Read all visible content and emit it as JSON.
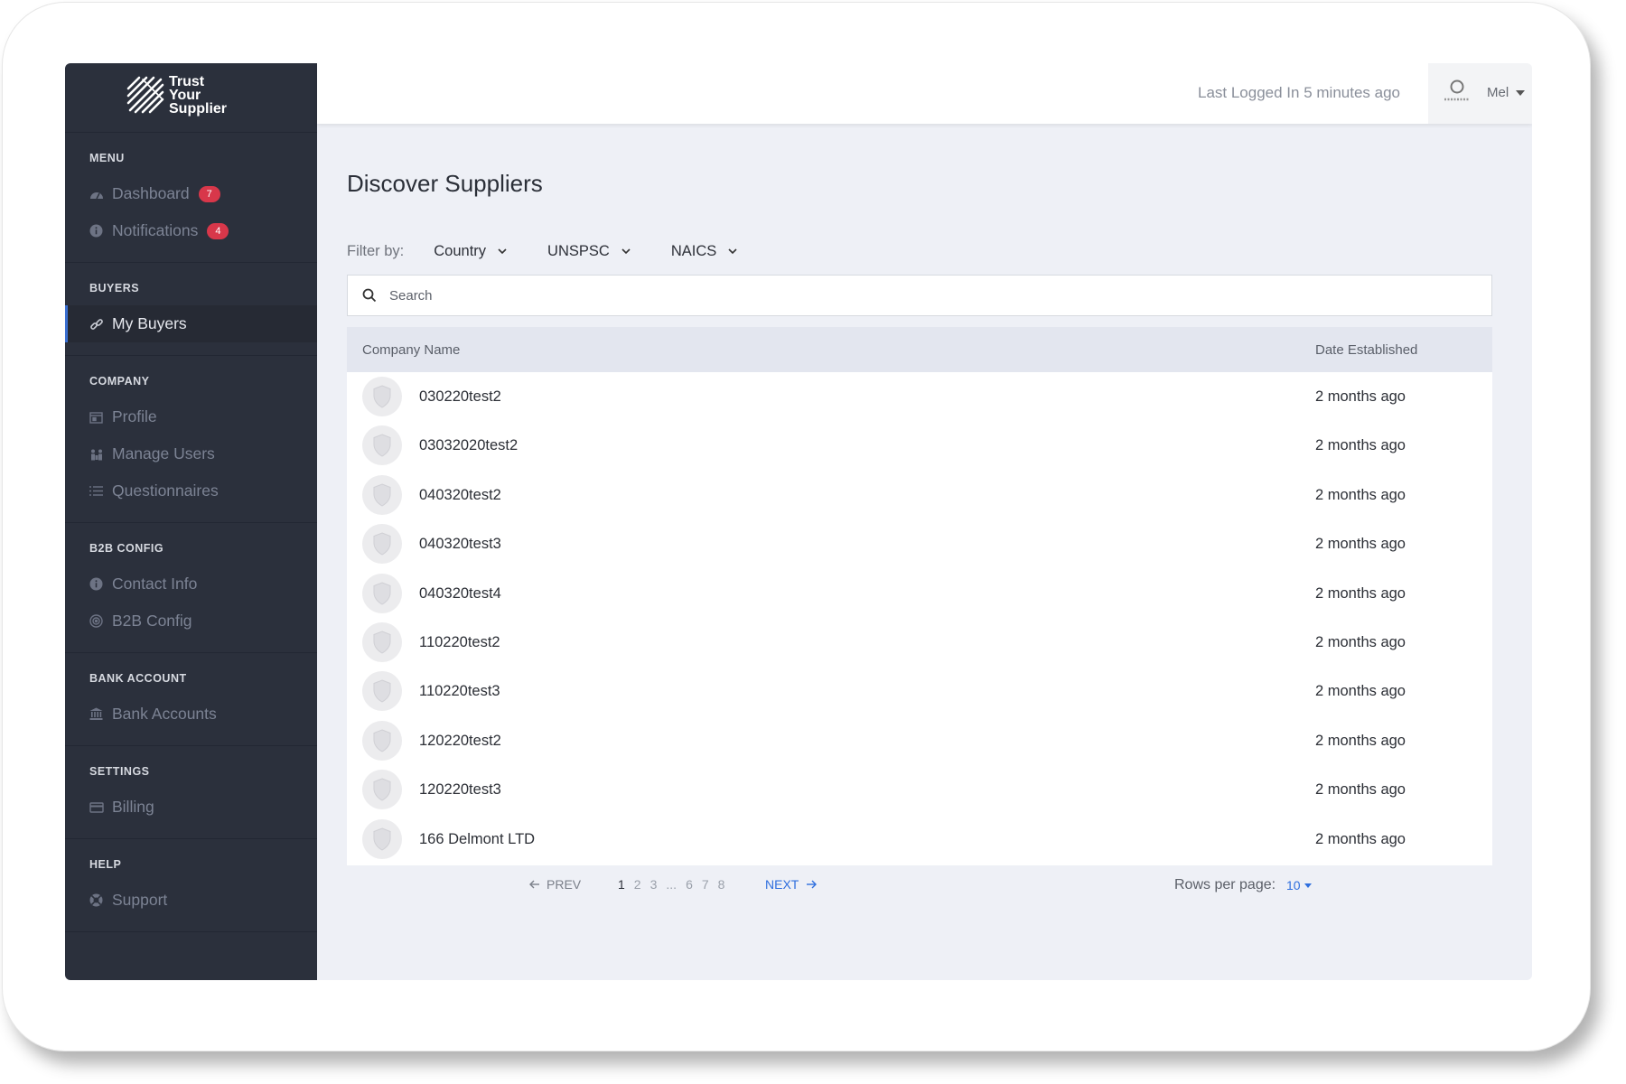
{
  "brand": {
    "line1": "Trust",
    "line2": "Your",
    "line3": "Supplier"
  },
  "sidebar": {
    "sections": [
      {
        "title": "MENU",
        "items": [
          {
            "label": "Dashboard",
            "icon": "dashboard-gauge-icon",
            "badge": "7"
          },
          {
            "label": "Notifications",
            "icon": "info-icon",
            "badge": "4"
          }
        ]
      },
      {
        "title": "BUYERS",
        "items": [
          {
            "label": "My Buyers",
            "icon": "link-icon",
            "active": true
          }
        ]
      },
      {
        "title": "COMPANY",
        "items": [
          {
            "label": "Profile",
            "icon": "calendar-icon"
          },
          {
            "label": "Manage Users",
            "icon": "users-icon"
          },
          {
            "label": "Questionnaires",
            "icon": "list-icon"
          }
        ]
      },
      {
        "title": "B2B CONFIG",
        "items": [
          {
            "label": "Contact Info",
            "icon": "info-icon"
          },
          {
            "label": "B2B Config",
            "icon": "target-icon"
          }
        ]
      },
      {
        "title": "BANK ACCOUNT",
        "items": [
          {
            "label": "Bank Accounts",
            "icon": "bank-icon"
          }
        ]
      },
      {
        "title": "SETTINGS",
        "items": [
          {
            "label": "Billing",
            "icon": "card-icon"
          }
        ]
      },
      {
        "title": "HELP",
        "items": [
          {
            "label": "Support",
            "icon": "support-icon"
          }
        ]
      }
    ]
  },
  "header": {
    "last_login": "Last Logged In 5 minutes ago",
    "user_name": "Mel"
  },
  "main": {
    "title": "Discover Suppliers",
    "filter_label": "Filter by:",
    "filters": [
      "Country",
      "UNSPSC",
      "NAICS"
    ],
    "search_placeholder": "Search",
    "columns": {
      "name": "Company Name",
      "date": "Date Established"
    },
    "rows": [
      {
        "name": "030220test2",
        "date": "2 months ago"
      },
      {
        "name": "03032020test2",
        "date": "2 months ago"
      },
      {
        "name": "040320test2",
        "date": "2 months ago"
      },
      {
        "name": "040320test3",
        "date": "2 months ago"
      },
      {
        "name": "040320test4",
        "date": "2 months ago"
      },
      {
        "name": "110220test2",
        "date": "2 months ago"
      },
      {
        "name": "110220test3",
        "date": "2 months ago"
      },
      {
        "name": "120220test2",
        "date": "2 months ago"
      },
      {
        "name": "120220test3",
        "date": "2 months ago"
      },
      {
        "name": "166 Delmont LTD",
        "date": "2 months ago"
      }
    ]
  },
  "pagination": {
    "prev": "PREV",
    "next": "NEXT",
    "pages": [
      "1",
      "2",
      "3",
      "...",
      "6",
      "7",
      "8"
    ],
    "current": "1",
    "rows_per_page_label": "Rows per page:",
    "rows_per_page": "10"
  },
  "colors": {
    "sidebar_bg": "#2b303c",
    "badge": "#d8374a",
    "accent": "#2f6fde",
    "content_bg": "#eef0f6"
  }
}
